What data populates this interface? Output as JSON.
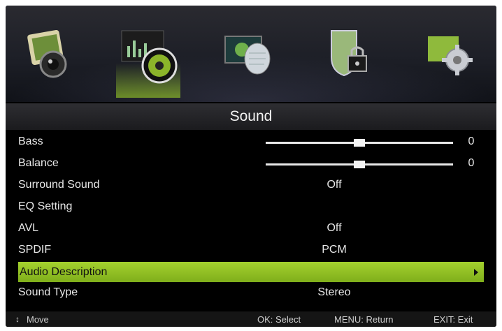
{
  "menu_title": "Sound",
  "tabs": [
    {
      "name": "picture-icon"
    },
    {
      "name": "sound-icon",
      "selected": true
    },
    {
      "name": "channel-icon"
    },
    {
      "name": "lock-icon"
    },
    {
      "name": "setup-icon"
    }
  ],
  "items": [
    {
      "label": "Bass",
      "type": "slider",
      "value": 0,
      "level": 0.5
    },
    {
      "label": "Balance",
      "type": "slider",
      "value": 0,
      "level": 0.5
    },
    {
      "label": "Surround Sound",
      "type": "option",
      "value": "Off"
    },
    {
      "label": "EQ Setting",
      "type": "submenu",
      "value": ""
    },
    {
      "label": "AVL",
      "type": "option",
      "value": "Off"
    },
    {
      "label": "SPDIF",
      "type": "option",
      "value": "PCM"
    },
    {
      "label": "Audio Description",
      "type": "submenu",
      "value": "",
      "highlighted": true
    },
    {
      "label": "Sound Type",
      "type": "option",
      "value": "Stereo"
    }
  ],
  "footer": {
    "move": "Move",
    "ok": "OK: Select",
    "menu": "MENU: Return",
    "exit": "EXIT: Exit"
  },
  "colors": {
    "highlight": "#98c62a",
    "background": "#000000"
  }
}
